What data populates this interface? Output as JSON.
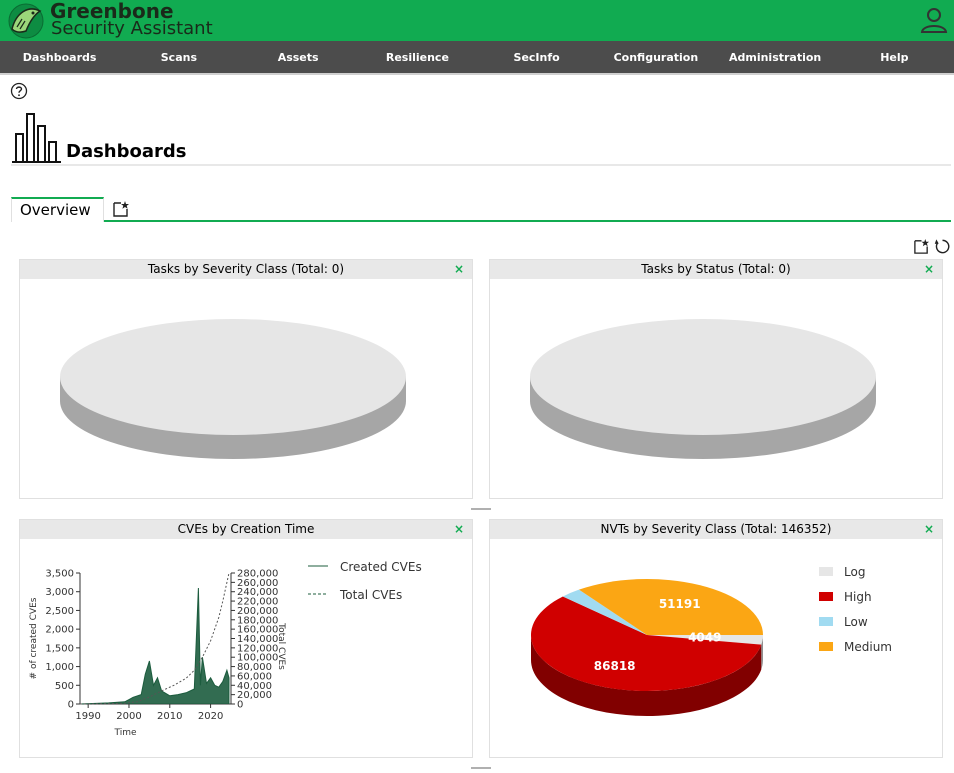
{
  "header": {
    "brand_line1": "Greenbone",
    "brand_line2": "Security Assistant"
  },
  "nav": [
    "Dashboards",
    "Scans",
    "Assets",
    "Resilience",
    "SecInfo",
    "Configuration",
    "Administration",
    "Help"
  ],
  "page": {
    "title": "Dashboards"
  },
  "tabs": [
    {
      "label": "Overview",
      "active": true
    }
  ],
  "panels": {
    "tasks_severity": {
      "title": "Tasks by Severity Class (Total: 0)",
      "close": "×"
    },
    "tasks_status": {
      "title": "Tasks by Status (Total: 0)",
      "close": "×"
    },
    "cves_time": {
      "title": "CVEs by Creation Time",
      "close": "×"
    },
    "nvts_severity": {
      "title": "NVTs by Severity Class (Total: 146352)",
      "close": "×"
    }
  },
  "colors": {
    "brand": "#11ab51",
    "nav_bg": "#4c4c4c",
    "high": "#d00000",
    "medium": "#fba614",
    "low": "#a1dbf1",
    "log": "#e6e6e6",
    "cve_line": "#1c5c3e"
  },
  "chart_data": [
    {
      "type": "line",
      "title": "CVEs by Creation Time",
      "xlabel": "Time",
      "ylabel": "# of created CVEs",
      "ylabel_right": "Total CVEs",
      "xlim": [
        1988,
        2025
      ],
      "ylim": [
        0,
        3500
      ],
      "ylim_right": [
        0,
        280000
      ],
      "x_ticks": [
        "1990",
        "2000",
        "2010",
        "2020"
      ],
      "y_ticks": [
        "0",
        "500",
        "1,000",
        "1,500",
        "2,000",
        "2,500",
        "3,000",
        "3,500"
      ],
      "y_ticks_right": [
        "0",
        "20,000",
        "40,000",
        "60,000",
        "80,000",
        "100,000",
        "120,000",
        "140,000",
        "160,000",
        "180,000",
        "200,000",
        "220,000",
        "240,000",
        "260,000",
        "280,000"
      ],
      "series": [
        {
          "name": "Created CVEs",
          "x": [
            1988,
            1995,
            1999,
            2001,
            2003,
            2004,
            2005,
            2006,
            2007,
            2008,
            2010,
            2012,
            2014,
            2016,
            2017,
            2017.5,
            2018,
            2019,
            2020,
            2021,
            2022,
            2023,
            2024,
            2024.5
          ],
          "y": [
            0,
            30,
            60,
            180,
            250,
            800,
            1150,
            500,
            700,
            350,
            220,
            250,
            300,
            400,
            3100,
            500,
            1250,
            550,
            700,
            500,
            450,
            600,
            900,
            700
          ]
        },
        {
          "name": "Total CVEs",
          "x": [
            1988,
            1999,
            2002,
            2005,
            2008,
            2011,
            2014,
            2016,
            2018,
            2020,
            2022,
            2023,
            2024,
            2024.5
          ],
          "y": [
            0,
            1500,
            5000,
            15000,
            28000,
            40000,
            55000,
            72000,
            100000,
            135000,
            185000,
            220000,
            260000,
            280000
          ]
        }
      ]
    },
    {
      "type": "pie",
      "title": "NVTs by Severity Class (Total: 146352)",
      "labels": [
        "Log",
        "High",
        "Low",
        "Medium"
      ],
      "values": [
        4049,
        86818,
        4294,
        51191
      ],
      "data_labels": [
        "4049",
        "86818",
        "",
        "51191"
      ]
    }
  ]
}
